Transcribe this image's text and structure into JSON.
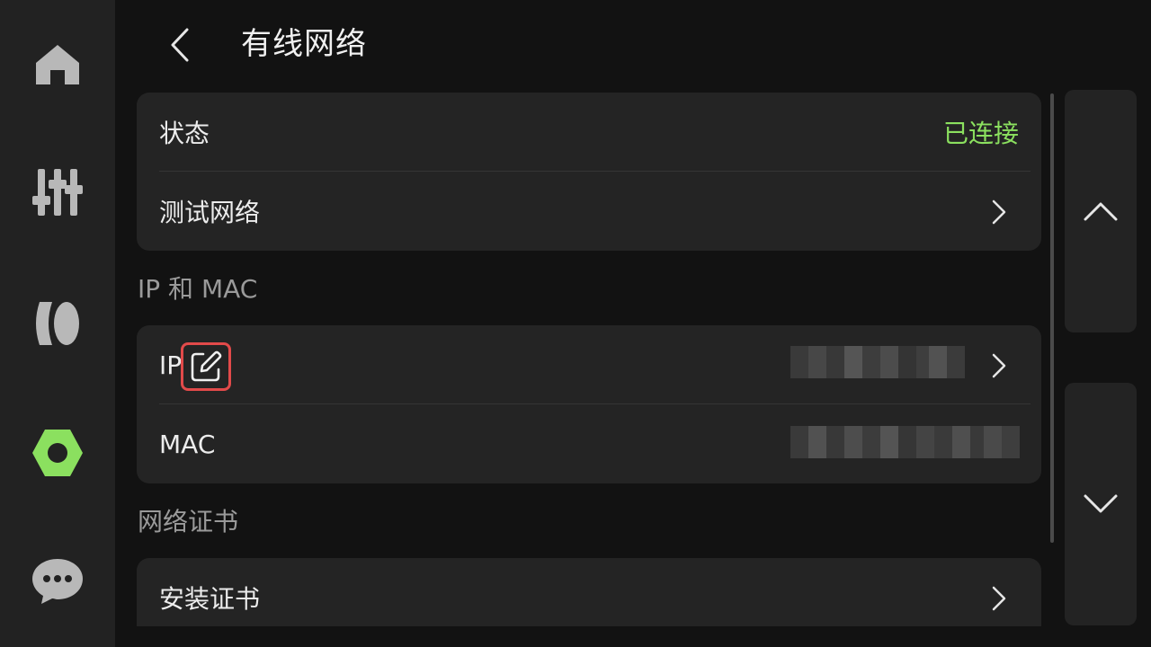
{
  "header": {
    "title": "有线网络"
  },
  "nav": {
    "items": [
      {
        "icon": "home-icon"
      },
      {
        "icon": "sliders-icon"
      },
      {
        "icon": "filament-icon"
      },
      {
        "icon": "settings-icon",
        "active": true
      },
      {
        "icon": "chat-icon"
      }
    ],
    "active_color": "#8be05f",
    "inactive_color": "#b8b8b8"
  },
  "status_card": {
    "status_label": "状态",
    "status_value": "已连接",
    "test_label": "测试网络"
  },
  "ip_mac_section": {
    "title": "IP 和 MAC",
    "ip_label": "IP",
    "mac_label": "MAC"
  },
  "cert_section": {
    "title": "网络证书",
    "install_label": "安装证书"
  },
  "colors": {
    "accent_green": "#8be05f",
    "highlight_red": "#e24a4a"
  }
}
